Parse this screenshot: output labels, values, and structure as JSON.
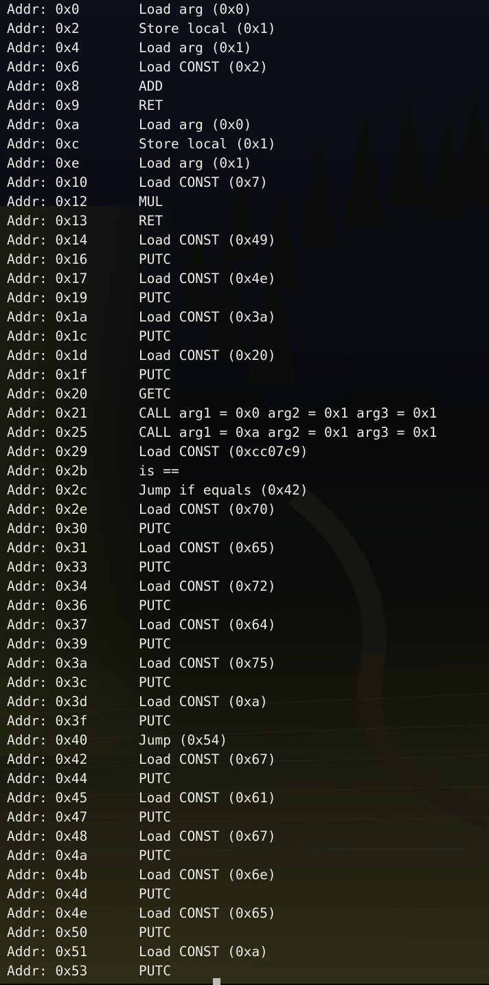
{
  "terminal": {
    "lines": [
      {
        "addr": "Addr: 0x0",
        "op": "Load arg (0x0)"
      },
      {
        "addr": "Addr: 0x2",
        "op": "Store local (0x1)"
      },
      {
        "addr": "Addr: 0x4",
        "op": "Load arg (0x1)"
      },
      {
        "addr": "Addr: 0x6",
        "op": "Load CONST (0x2)"
      },
      {
        "addr": "Addr: 0x8",
        "op": "ADD"
      },
      {
        "addr": "Addr: 0x9",
        "op": "RET"
      },
      {
        "addr": "Addr: 0xa",
        "op": "Load arg (0x0)"
      },
      {
        "addr": "Addr: 0xc",
        "op": "Store local (0x1)"
      },
      {
        "addr": "Addr: 0xe",
        "op": "Load arg (0x1)"
      },
      {
        "addr": "Addr: 0x10",
        "op": "Load CONST (0x7)"
      },
      {
        "addr": "Addr: 0x12",
        "op": "MUL"
      },
      {
        "addr": "Addr: 0x13",
        "op": "RET"
      },
      {
        "addr": "Addr: 0x14",
        "op": "Load CONST (0x49)"
      },
      {
        "addr": "Addr: 0x16",
        "op": "PUTC"
      },
      {
        "addr": "Addr: 0x17",
        "op": "Load CONST (0x4e)"
      },
      {
        "addr": "Addr: 0x19",
        "op": "PUTC"
      },
      {
        "addr": "Addr: 0x1a",
        "op": "Load CONST (0x3a)"
      },
      {
        "addr": "Addr: 0x1c",
        "op": "PUTC"
      },
      {
        "addr": "Addr: 0x1d",
        "op": "Load CONST (0x20)"
      },
      {
        "addr": "Addr: 0x1f",
        "op": "PUTC"
      },
      {
        "addr": "Addr: 0x20",
        "op": "GETC"
      },
      {
        "addr": "Addr: 0x21",
        "op": "CALL arg1 = 0x0 arg2 = 0x1 arg3 = 0x1"
      },
      {
        "addr": "Addr: 0x25",
        "op": "CALL arg1 = 0xa arg2 = 0x1 arg3 = 0x1"
      },
      {
        "addr": "Addr: 0x29",
        "op": "Load CONST (0xcc07c9)"
      },
      {
        "addr": "Addr: 0x2b",
        "op": "is =="
      },
      {
        "addr": "Addr: 0x2c",
        "op": "Jump if equals (0x42)"
      },
      {
        "addr": "Addr: 0x2e",
        "op": "Load CONST (0x70)"
      },
      {
        "addr": "Addr: 0x30",
        "op": "PUTC"
      },
      {
        "addr": "Addr: 0x31",
        "op": "Load CONST (0x65)"
      },
      {
        "addr": "Addr: 0x33",
        "op": "PUTC"
      },
      {
        "addr": "Addr: 0x34",
        "op": "Load CONST (0x72)"
      },
      {
        "addr": "Addr: 0x36",
        "op": "PUTC"
      },
      {
        "addr": "Addr: 0x37",
        "op": "Load CONST (0x64)"
      },
      {
        "addr": "Addr: 0x39",
        "op": "PUTC"
      },
      {
        "addr": "Addr: 0x3a",
        "op": "Load CONST (0x75)"
      },
      {
        "addr": "Addr: 0x3c",
        "op": "PUTC"
      },
      {
        "addr": "Addr: 0x3d",
        "op": "Load CONST (0xa)"
      },
      {
        "addr": "Addr: 0x3f",
        "op": "PUTC"
      },
      {
        "addr": "Addr: 0x40",
        "op": "Jump (0x54)"
      },
      {
        "addr": "Addr: 0x42",
        "op": "Load CONST (0x67)"
      },
      {
        "addr": "Addr: 0x44",
        "op": "PUTC"
      },
      {
        "addr": "Addr: 0x45",
        "op": "Load CONST (0x61)"
      },
      {
        "addr": "Addr: 0x47",
        "op": "PUTC"
      },
      {
        "addr": "Addr: 0x48",
        "op": "Load CONST (0x67)"
      },
      {
        "addr": "Addr: 0x4a",
        "op": "PUTC"
      },
      {
        "addr": "Addr: 0x4b",
        "op": "Load CONST (0x6e)"
      },
      {
        "addr": "Addr: 0x4d",
        "op": "PUTC"
      },
      {
        "addr": "Addr: 0x4e",
        "op": "Load CONST (0x65)"
      },
      {
        "addr": "Addr: 0x50",
        "op": "PUTC"
      },
      {
        "addr": "Addr: 0x51",
        "op": "Load CONST (0xa)"
      },
      {
        "addr": "Addr: 0x53",
        "op": "PUTC"
      }
    ]
  }
}
